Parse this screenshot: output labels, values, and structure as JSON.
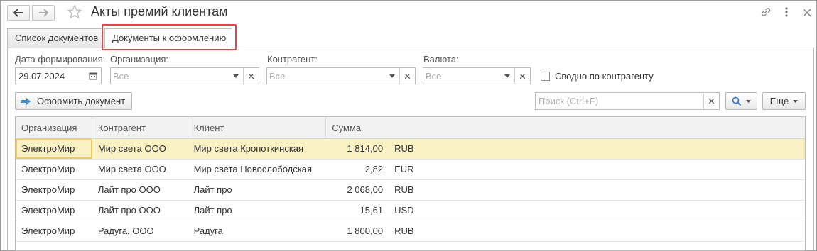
{
  "window": {
    "title": "Акты премий клиентам"
  },
  "icons": {
    "back": "arrow-left-icon",
    "forward": "arrow-right-icon",
    "favorite": "star-icon",
    "link": "link-icon",
    "more": "more-vertical-icon",
    "close": "close-icon"
  },
  "tabs": [
    {
      "label": "Список документов"
    },
    {
      "label": "Документы к оформлению"
    }
  ],
  "filters": {
    "date_label": "Дата формирования:",
    "date_value": "29.07.2024",
    "org_label": "Организация:",
    "org_placeholder": "Все",
    "counterparty_label": "Контрагент:",
    "counterparty_placeholder": "Все",
    "currency_label": "Валюта:",
    "currency_placeholder": "Все",
    "summary_label": "Сводно по контрагенту"
  },
  "toolbar": {
    "make_document_label": "Оформить документ",
    "search_placeholder": "Поиск (Ctrl+F)",
    "more_label": "Еще"
  },
  "table": {
    "columns": [
      "Организация",
      "Контрагент",
      "Клиент",
      "Сумма"
    ],
    "rows": [
      {
        "org": "ЭлектроМир",
        "counterparty": "Мир света ООО",
        "client": "Мир света Кропоткинская",
        "sum": "1 814,00",
        "currency": "RUB"
      },
      {
        "org": "ЭлектроМир",
        "counterparty": "Мир света ООО",
        "client": "Мир света Новослободская",
        "sum": "2,82",
        "currency": "EUR"
      },
      {
        "org": "ЭлектроМир",
        "counterparty": "Лайт про ООО",
        "client": "Лайт про",
        "sum": "2 068,00",
        "currency": "RUB"
      },
      {
        "org": "ЭлектроМир",
        "counterparty": "Лайт про ООО",
        "client": "Лайт про",
        "sum": "15,61",
        "currency": "USD"
      },
      {
        "org": "ЭлектроМир",
        "counterparty": "Радуга, ООО",
        "client": "Радуга",
        "sum": "1 800,00",
        "currency": "RUB"
      }
    ]
  },
  "colors": {
    "selected_row": "#faf1c4",
    "focus_cell_border": "#f0c95c",
    "tab_highlight": "#e04646",
    "accent_arrow": "#3d8fd6"
  }
}
